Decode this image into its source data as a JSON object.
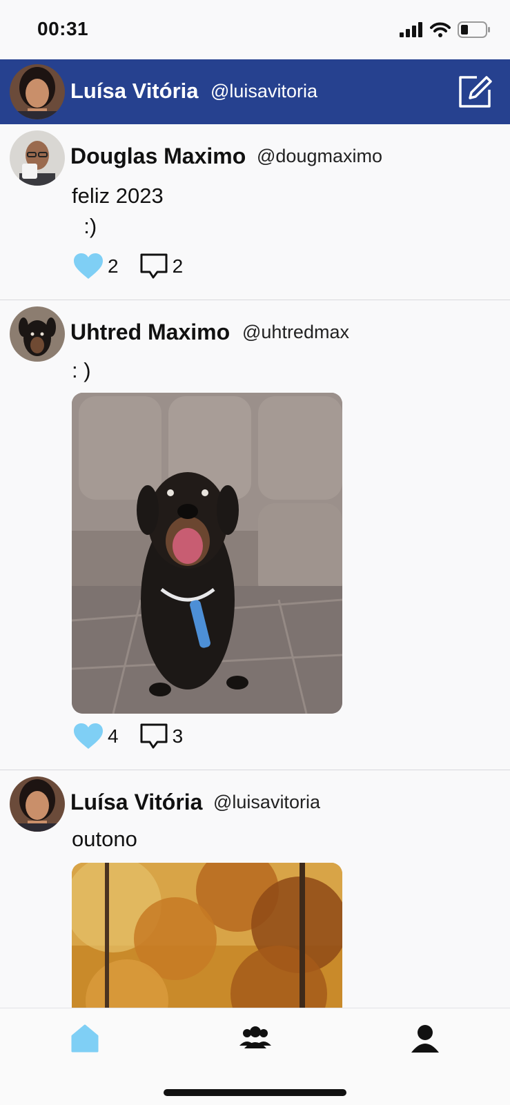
{
  "status_bar": {
    "time": "00:31"
  },
  "header": {
    "name": "Luísa Vitória",
    "handle": "@luisavitoria",
    "compose_icon": "compose-icon"
  },
  "posts": [
    {
      "name": "Douglas Maximo",
      "handle": "@dougmaximo",
      "text": "feliz 2023\n  :)",
      "likes": "2",
      "comments": "2",
      "has_image": false
    },
    {
      "name": "Uhtred Maximo",
      "handle": "@uhtredmax",
      "text": ": )",
      "likes": "4",
      "comments": "3",
      "has_image": true
    },
    {
      "name": "Luísa Vitória",
      "handle": "@luisavitoria",
      "text": "outono",
      "has_image": true
    }
  ],
  "tabs": [
    {
      "icon": "home-icon",
      "active": true
    },
    {
      "icon": "people-icon",
      "active": false
    },
    {
      "icon": "profile-icon",
      "active": false
    }
  ],
  "colors": {
    "header": "#26418f",
    "like": "#7fcff5",
    "active_tab": "#7fcff5"
  }
}
